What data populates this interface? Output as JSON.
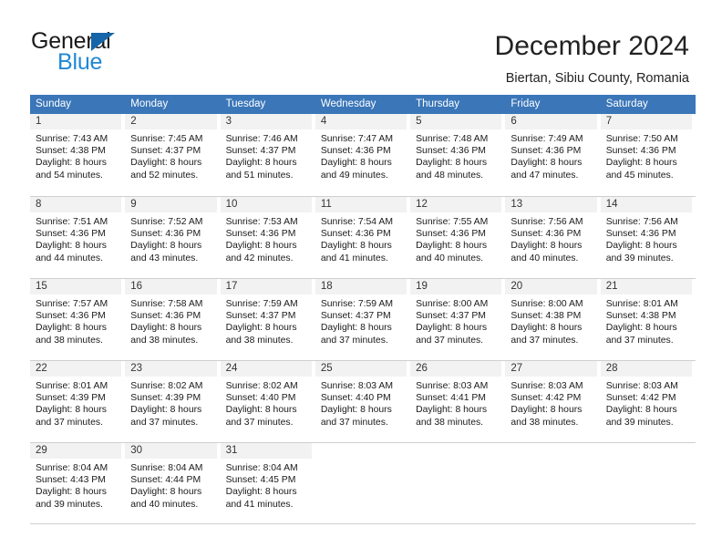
{
  "brand": {
    "name_primary": "General",
    "name_secondary": "Blue"
  },
  "header": {
    "title": "December 2024",
    "subtitle": "Biertan, Sibiu County, Romania"
  },
  "colors": {
    "header_row_blue": "#3a76b8",
    "daynum_band_gray": "#f2f2f2",
    "grid_line": "#cfcfcf",
    "logo_blue": "#2088d6",
    "logo_triangle_blue": "#1565a8"
  },
  "weekdays": [
    "Sunday",
    "Monday",
    "Tuesday",
    "Wednesday",
    "Thursday",
    "Friday",
    "Saturday"
  ],
  "weeks": [
    [
      {
        "day": "1",
        "sunrise": "Sunrise: 7:43 AM",
        "sunset": "Sunset: 4:38 PM",
        "daylight_line1": "Daylight: 8 hours",
        "daylight_line2": "and 54 minutes."
      },
      {
        "day": "2",
        "sunrise": "Sunrise: 7:45 AM",
        "sunset": "Sunset: 4:37 PM",
        "daylight_line1": "Daylight: 8 hours",
        "daylight_line2": "and 52 minutes."
      },
      {
        "day": "3",
        "sunrise": "Sunrise: 7:46 AM",
        "sunset": "Sunset: 4:37 PM",
        "daylight_line1": "Daylight: 8 hours",
        "daylight_line2": "and 51 minutes."
      },
      {
        "day": "4",
        "sunrise": "Sunrise: 7:47 AM",
        "sunset": "Sunset: 4:36 PM",
        "daylight_line1": "Daylight: 8 hours",
        "daylight_line2": "and 49 minutes."
      },
      {
        "day": "5",
        "sunrise": "Sunrise: 7:48 AM",
        "sunset": "Sunset: 4:36 PM",
        "daylight_line1": "Daylight: 8 hours",
        "daylight_line2": "and 48 minutes."
      },
      {
        "day": "6",
        "sunrise": "Sunrise: 7:49 AM",
        "sunset": "Sunset: 4:36 PM",
        "daylight_line1": "Daylight: 8 hours",
        "daylight_line2": "and 47 minutes."
      },
      {
        "day": "7",
        "sunrise": "Sunrise: 7:50 AM",
        "sunset": "Sunset: 4:36 PM",
        "daylight_line1": "Daylight: 8 hours",
        "daylight_line2": "and 45 minutes."
      }
    ],
    [
      {
        "day": "8",
        "sunrise": "Sunrise: 7:51 AM",
        "sunset": "Sunset: 4:36 PM",
        "daylight_line1": "Daylight: 8 hours",
        "daylight_line2": "and 44 minutes."
      },
      {
        "day": "9",
        "sunrise": "Sunrise: 7:52 AM",
        "sunset": "Sunset: 4:36 PM",
        "daylight_line1": "Daylight: 8 hours",
        "daylight_line2": "and 43 minutes."
      },
      {
        "day": "10",
        "sunrise": "Sunrise: 7:53 AM",
        "sunset": "Sunset: 4:36 PM",
        "daylight_line1": "Daylight: 8 hours",
        "daylight_line2": "and 42 minutes."
      },
      {
        "day": "11",
        "sunrise": "Sunrise: 7:54 AM",
        "sunset": "Sunset: 4:36 PM",
        "daylight_line1": "Daylight: 8 hours",
        "daylight_line2": "and 41 minutes."
      },
      {
        "day": "12",
        "sunrise": "Sunrise: 7:55 AM",
        "sunset": "Sunset: 4:36 PM",
        "daylight_line1": "Daylight: 8 hours",
        "daylight_line2": "and 40 minutes."
      },
      {
        "day": "13",
        "sunrise": "Sunrise: 7:56 AM",
        "sunset": "Sunset: 4:36 PM",
        "daylight_line1": "Daylight: 8 hours",
        "daylight_line2": "and 40 minutes."
      },
      {
        "day": "14",
        "sunrise": "Sunrise: 7:56 AM",
        "sunset": "Sunset: 4:36 PM",
        "daylight_line1": "Daylight: 8 hours",
        "daylight_line2": "and 39 minutes."
      }
    ],
    [
      {
        "day": "15",
        "sunrise": "Sunrise: 7:57 AM",
        "sunset": "Sunset: 4:36 PM",
        "daylight_line1": "Daylight: 8 hours",
        "daylight_line2": "and 38 minutes."
      },
      {
        "day": "16",
        "sunrise": "Sunrise: 7:58 AM",
        "sunset": "Sunset: 4:36 PM",
        "daylight_line1": "Daylight: 8 hours",
        "daylight_line2": "and 38 minutes."
      },
      {
        "day": "17",
        "sunrise": "Sunrise: 7:59 AM",
        "sunset": "Sunset: 4:37 PM",
        "daylight_line1": "Daylight: 8 hours",
        "daylight_line2": "and 38 minutes."
      },
      {
        "day": "18",
        "sunrise": "Sunrise: 7:59 AM",
        "sunset": "Sunset: 4:37 PM",
        "daylight_line1": "Daylight: 8 hours",
        "daylight_line2": "and 37 minutes."
      },
      {
        "day": "19",
        "sunrise": "Sunrise: 8:00 AM",
        "sunset": "Sunset: 4:37 PM",
        "daylight_line1": "Daylight: 8 hours",
        "daylight_line2": "and 37 minutes."
      },
      {
        "day": "20",
        "sunrise": "Sunrise: 8:00 AM",
        "sunset": "Sunset: 4:38 PM",
        "daylight_line1": "Daylight: 8 hours",
        "daylight_line2": "and 37 minutes."
      },
      {
        "day": "21",
        "sunrise": "Sunrise: 8:01 AM",
        "sunset": "Sunset: 4:38 PM",
        "daylight_line1": "Daylight: 8 hours",
        "daylight_line2": "and 37 minutes."
      }
    ],
    [
      {
        "day": "22",
        "sunrise": "Sunrise: 8:01 AM",
        "sunset": "Sunset: 4:39 PM",
        "daylight_line1": "Daylight: 8 hours",
        "daylight_line2": "and 37 minutes."
      },
      {
        "day": "23",
        "sunrise": "Sunrise: 8:02 AM",
        "sunset": "Sunset: 4:39 PM",
        "daylight_line1": "Daylight: 8 hours",
        "daylight_line2": "and 37 minutes."
      },
      {
        "day": "24",
        "sunrise": "Sunrise: 8:02 AM",
        "sunset": "Sunset: 4:40 PM",
        "daylight_line1": "Daylight: 8 hours",
        "daylight_line2": "and 37 minutes."
      },
      {
        "day": "25",
        "sunrise": "Sunrise: 8:03 AM",
        "sunset": "Sunset: 4:40 PM",
        "daylight_line1": "Daylight: 8 hours",
        "daylight_line2": "and 37 minutes."
      },
      {
        "day": "26",
        "sunrise": "Sunrise: 8:03 AM",
        "sunset": "Sunset: 4:41 PM",
        "daylight_line1": "Daylight: 8 hours",
        "daylight_line2": "and 38 minutes."
      },
      {
        "day": "27",
        "sunrise": "Sunrise: 8:03 AM",
        "sunset": "Sunset: 4:42 PM",
        "daylight_line1": "Daylight: 8 hours",
        "daylight_line2": "and 38 minutes."
      },
      {
        "day": "28",
        "sunrise": "Sunrise: 8:03 AM",
        "sunset": "Sunset: 4:42 PM",
        "daylight_line1": "Daylight: 8 hours",
        "daylight_line2": "and 39 minutes."
      }
    ],
    [
      {
        "day": "29",
        "sunrise": "Sunrise: 8:04 AM",
        "sunset": "Sunset: 4:43 PM",
        "daylight_line1": "Daylight: 8 hours",
        "daylight_line2": "and 39 minutes."
      },
      {
        "day": "30",
        "sunrise": "Sunrise: 8:04 AM",
        "sunset": "Sunset: 4:44 PM",
        "daylight_line1": "Daylight: 8 hours",
        "daylight_line2": "and 40 minutes."
      },
      {
        "day": "31",
        "sunrise": "Sunrise: 8:04 AM",
        "sunset": "Sunset: 4:45 PM",
        "daylight_line1": "Daylight: 8 hours",
        "daylight_line2": "and 41 minutes."
      },
      {
        "day": "",
        "sunrise": "",
        "sunset": "",
        "daylight_line1": "",
        "daylight_line2": ""
      },
      {
        "day": "",
        "sunrise": "",
        "sunset": "",
        "daylight_line1": "",
        "daylight_line2": ""
      },
      {
        "day": "",
        "sunrise": "",
        "sunset": "",
        "daylight_line1": "",
        "daylight_line2": ""
      },
      {
        "day": "",
        "sunrise": "",
        "sunset": "",
        "daylight_line1": "",
        "daylight_line2": ""
      }
    ]
  ]
}
